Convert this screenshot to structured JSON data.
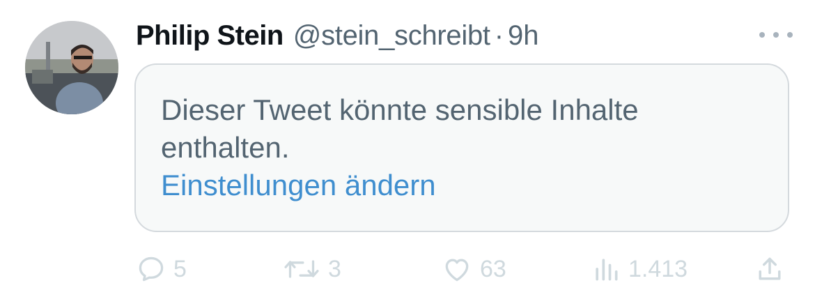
{
  "tweet": {
    "author": {
      "display_name": "Philip Stein",
      "handle": "@stein_schreibt",
      "separator": "·",
      "time": "9h"
    },
    "sensitive_notice": {
      "text": "Dieser Tweet könnte sensible Inhalte enthalten.",
      "link_label": "Einstellungen ändern"
    },
    "actions": {
      "replies": "5",
      "retweets": "3",
      "likes": "63",
      "views": "1.413"
    },
    "icons": {
      "more": "more-dots-icon",
      "reply": "speech-bubble-icon",
      "retweet": "retweet-arrows-icon",
      "like": "heart-icon",
      "views": "bar-chart-icon",
      "share": "share-upload-icon"
    }
  }
}
